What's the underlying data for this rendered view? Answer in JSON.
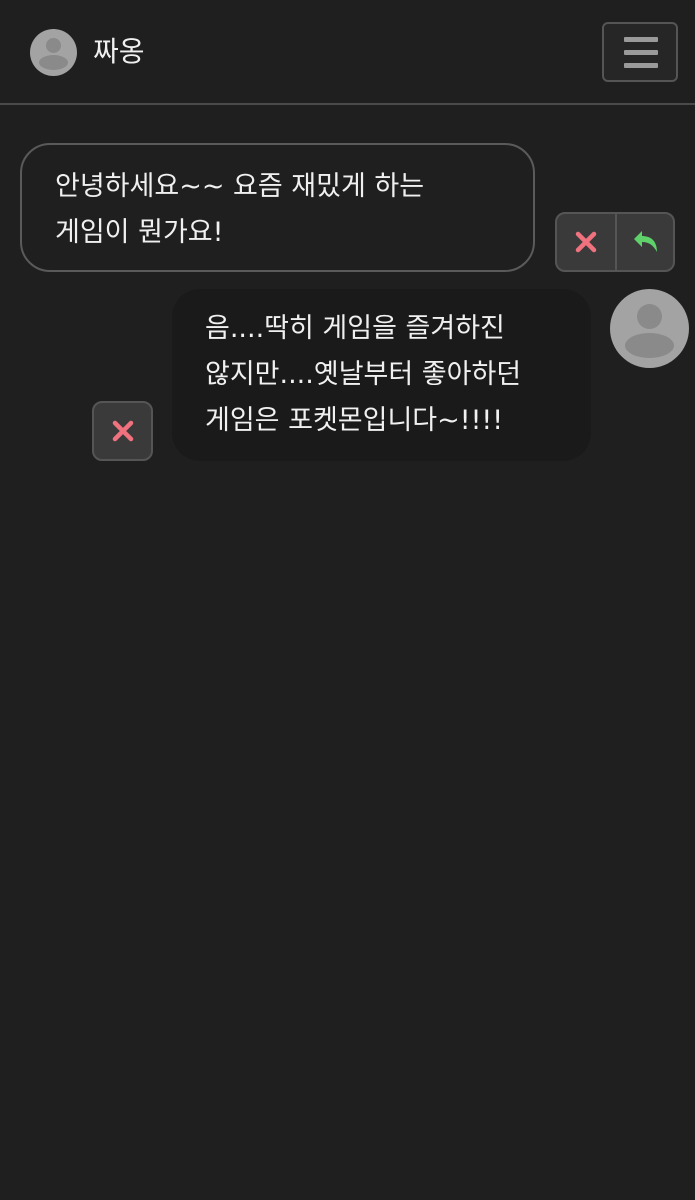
{
  "header": {
    "name": "짜옹"
  },
  "messages": [
    {
      "side": "left",
      "text": "안녕하세요~~ 요즘 재밌게 하는 게임이 뭔가요!"
    },
    {
      "side": "right",
      "text": "음....딱히 게임을 즐겨하진 않지만....옛날부터 좋아하던 게임은 포켓몬입니다~!!!!"
    }
  ],
  "colors": {
    "background": "#1f1f1f",
    "delete_icon": "#f0727f",
    "reply_icon": "#5fd16b",
    "avatar": "#a3a3a3"
  },
  "icons": {
    "menu": "hamburger-icon",
    "delete": "close-icon",
    "reply": "reply-arrow-icon",
    "avatar": "user-silhouette-icon"
  }
}
